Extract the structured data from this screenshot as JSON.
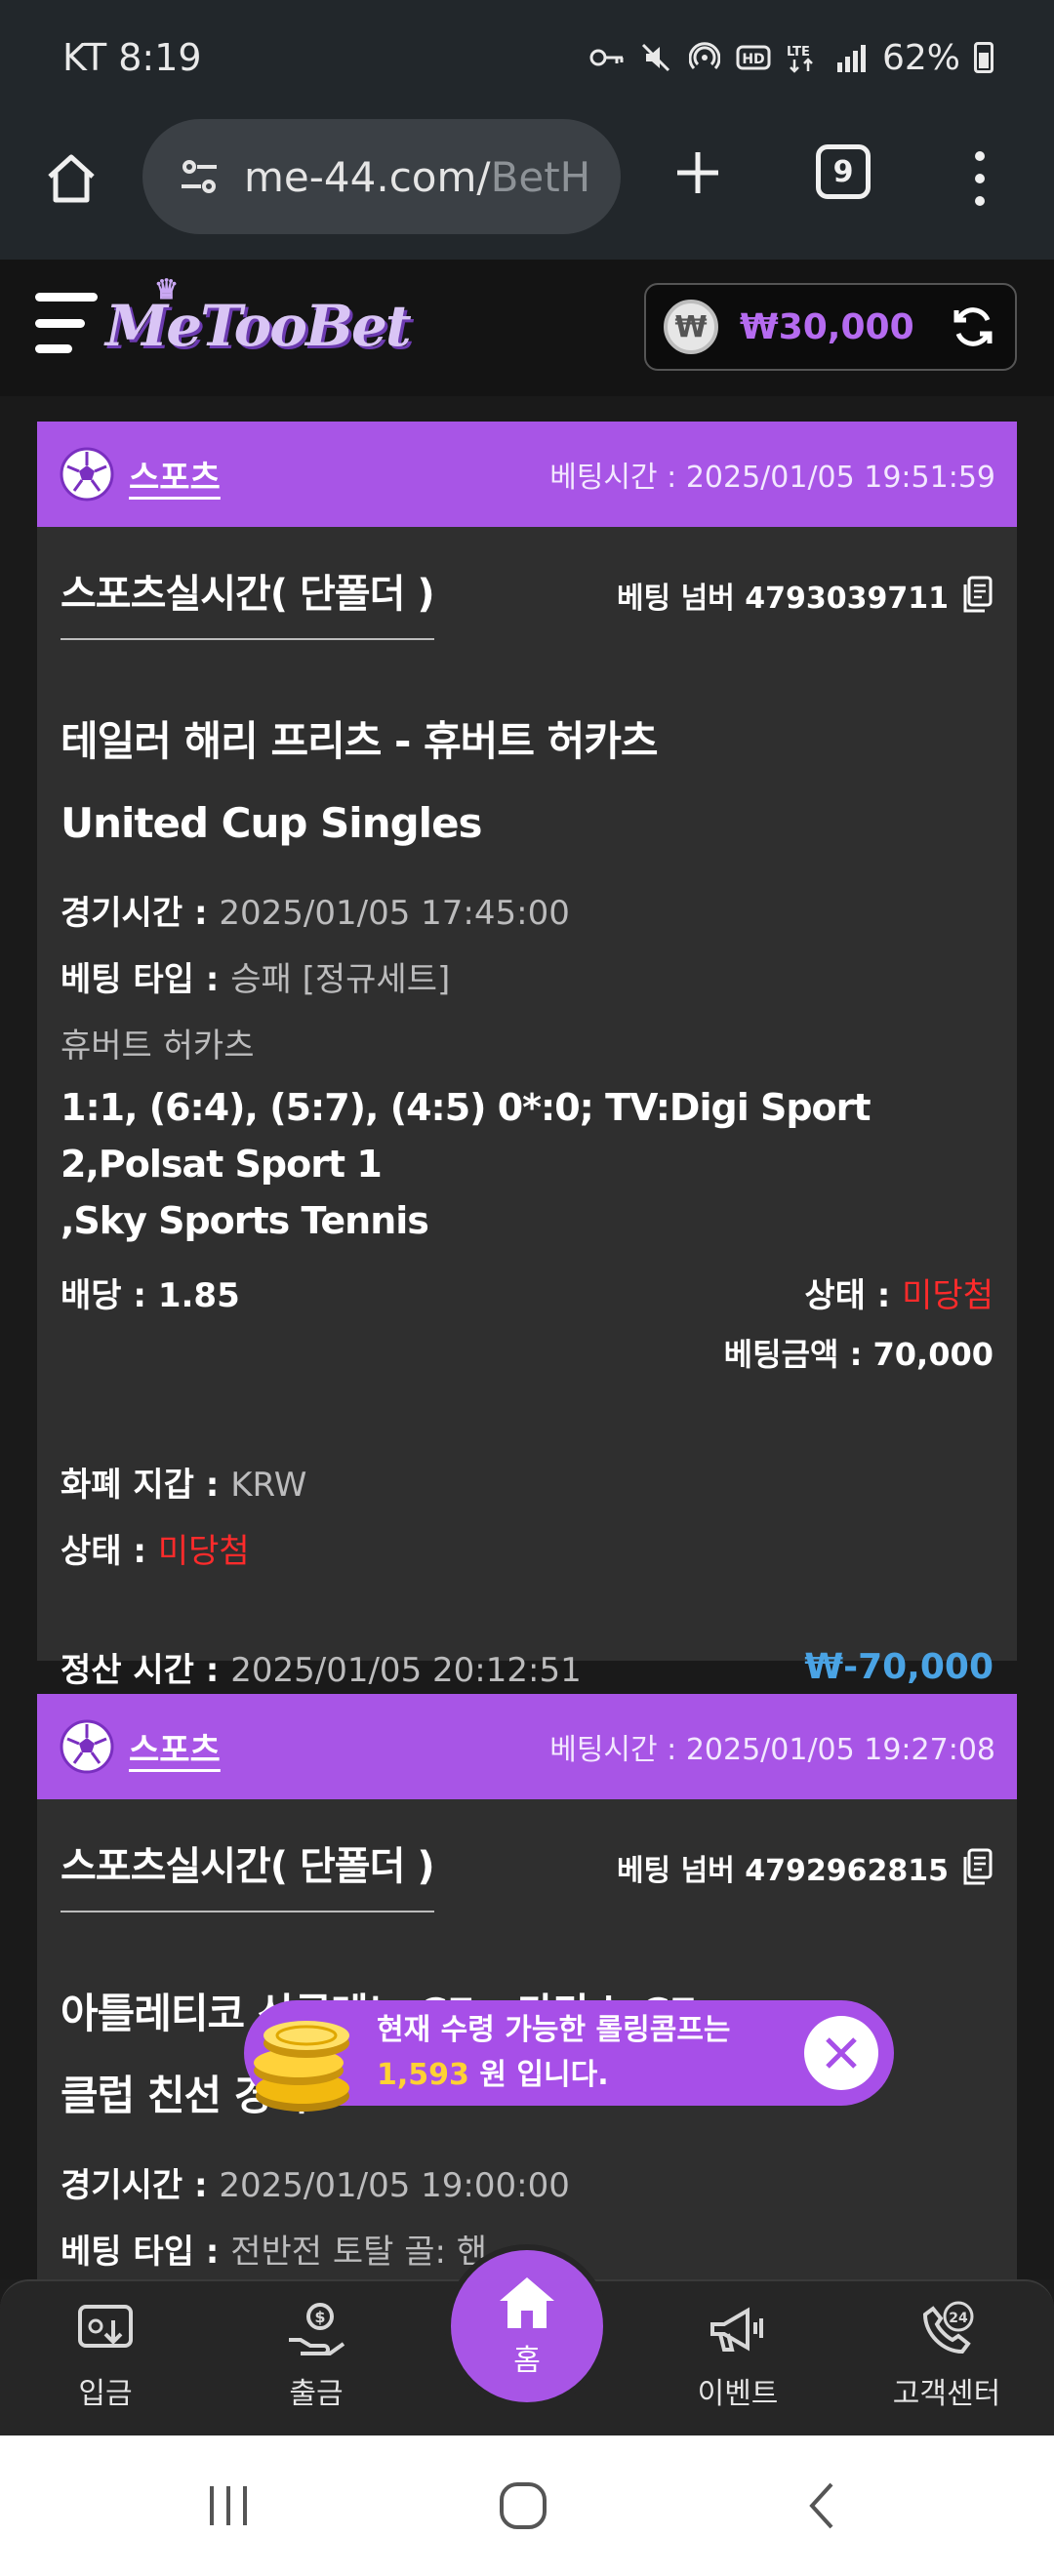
{
  "status_bar": {
    "time": "KT 8:19",
    "battery": "62%",
    "icons": [
      "key-icon",
      "mute-icon",
      "hotspot-icon",
      "hd-icon",
      "lte-icon",
      "signal-icon",
      "battery-icon"
    ]
  },
  "browser": {
    "url_main": "me-44.com/",
    "url_dim": "BetH",
    "tab_count": "9"
  },
  "site": {
    "logo": "MeTooBet",
    "balance": "₩30,000",
    "currency_symbol": "₩"
  },
  "bets": [
    {
      "category": "스포츠",
      "bet_time_label": "베팅시간 : ",
      "bet_time": "2025/01/05 19:51:59",
      "type_title": "스포츠실시간( 단폴더 )",
      "bet_number_label": "베팅 넘버 ",
      "bet_number": "4793039711",
      "match_line1": "테일러 해리 프리츠 - 휴버트 허카츠",
      "match_line2": "United Cup Singles",
      "game_time_label": "경기시간 : ",
      "game_time": "2025/01/05 17:45:00",
      "bet_type_label": "베팅 타입 : ",
      "bet_type": "승패 [정규세트]",
      "selection": "휴버트 허카츠",
      "score_line1": "1:1, (6:4), (5:7), (4:5) 0*:0; TV:Digi Sport 2,Polsat Sport 1",
      "score_line2": ",Sky Sports Tennis",
      "odds_label": "배당 : ",
      "odds": "1.85",
      "status_label": "상태 : ",
      "status": "미당첨",
      "amount_label": "베팅금액 : ",
      "amount": "70,000",
      "currency_label": "화폐 지갑 : ",
      "currency": "KRW",
      "status2_label": "상태 : ",
      "status2": "미당첨",
      "settle_label": "정산 시간 : ",
      "settle_time": "2025/01/05 20:12:51",
      "payout": "₩-70,000"
    },
    {
      "category": "스포츠",
      "bet_time_label": "베팅시간 : ",
      "bet_time": "2025/01/05 19:27:08",
      "type_title": "스포츠실시간( 단폴더 )",
      "bet_number_label": "베팅 넘버 ",
      "bet_number": "4792962815",
      "match_line1": "아틀레티코 산루레노 CF - 카라스 CF",
      "match_line2": "클럽 친선 경기",
      "game_time_label": "경기시간 : ",
      "game_time": "2025/01/05 19:00:00",
      "bet_type_label": "베팅 타입 : ",
      "bet_type": "전반전 토탈 골: 핸"
    }
  ],
  "toast": {
    "line1": "현재 수령 가능한 롤링콤프는",
    "amount": "1,593",
    "line2_suffix": " 원 입니다."
  },
  "bottom_nav": {
    "deposit": "입금",
    "withdraw": "출금",
    "home": "홈",
    "event": "이벤트",
    "support": "고객센터"
  },
  "colors": {
    "accent": "#a855e6",
    "lost": "#ff2b2b",
    "payout": "#4aa3e4"
  }
}
